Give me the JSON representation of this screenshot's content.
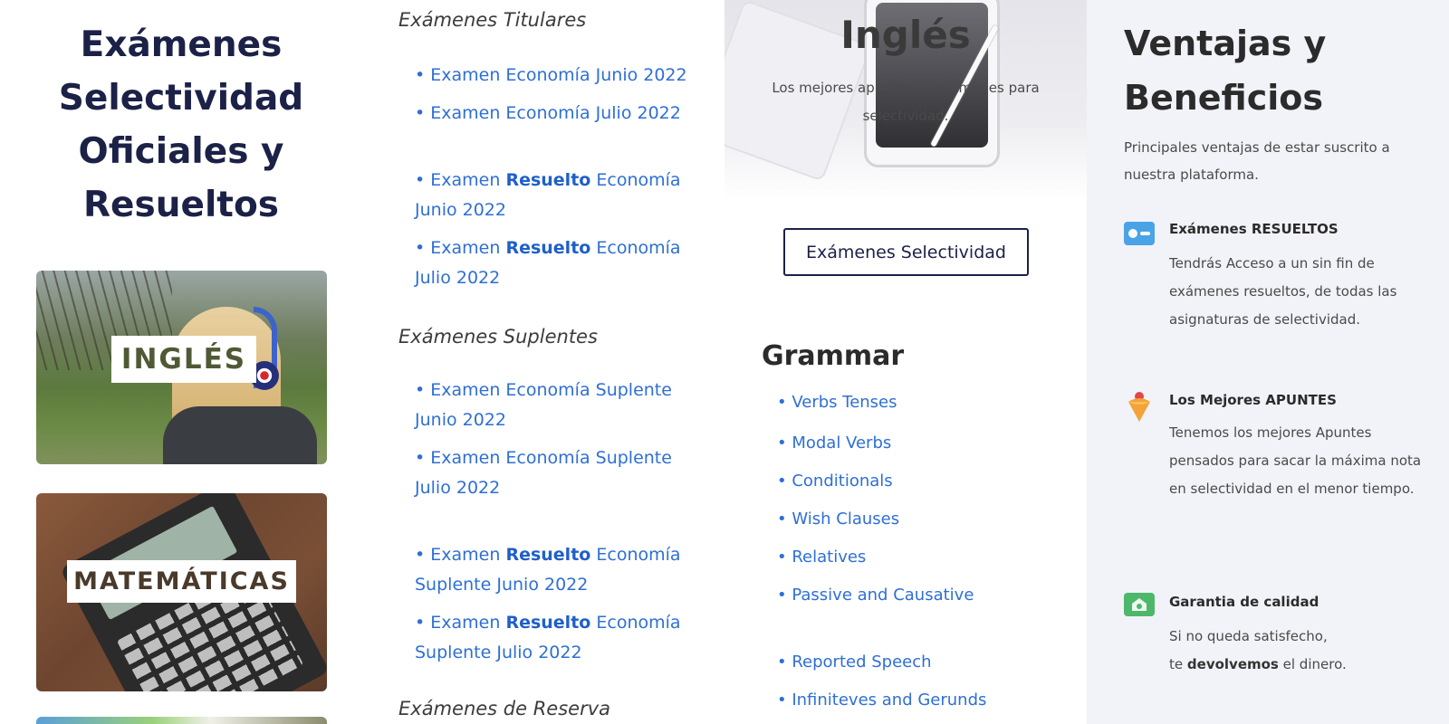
{
  "panel_selectividad": {
    "title": "Exámenes Selectividad Oficiales y Resueltos",
    "cards": [
      {
        "label": "INGLÉS"
      },
      {
        "label": "MATEMÁTICAS"
      }
    ]
  },
  "panel_examenes": {
    "sections": [
      {
        "heading": "Exámenes Titulares"
      },
      {
        "heading": "Exámenes Suplentes"
      },
      {
        "heading": "Exámenes de Reserva"
      }
    ],
    "links": {
      "titular_junio": "• Examen Economía Junio 2022",
      "titular_julio": "• Examen Economía Julio 2022",
      "resuelto_prefix": "• Examen",
      "resuelto_word": "Resuelto",
      "resuelto_junio_rest": "Economía Junio 2022",
      "resuelto_julio_rest": "Economía Julio 2022",
      "suplente_junio": "• Examen Economía Suplente Junio 2022",
      "suplente_julio": "• Examen Economía Suplente Julio 2022",
      "resuelto_suplente_junio_rest": "Economía Suplente Junio 2022",
      "resuelto_suplente_julio_rest": "Economía Suplente Julio 2022"
    }
  },
  "panel_ingles": {
    "hero_title": "Inglés",
    "hero_subtitle": "Los mejores apuntes y resúmenes para selectividad.",
    "button_label": "Exámenes Selectividad",
    "grammar_title": "Grammar",
    "grammar_links": [
      "• Verbs Tenses",
      "• Modal Verbs",
      "• Conditionals",
      "• Wish Clauses",
      "• Relatives",
      "• Passive and Causative",
      "• Reported Speech",
      "• Infiniteves and Gerunds"
    ]
  },
  "panel_beneficios": {
    "title": "Ventajas y Beneficios",
    "subtitle": "Principales ventajas de estar suscrito a nuestra plataforma.",
    "items": [
      {
        "icon": "id-card-icon",
        "heading": "Exámenes RESUELTOS",
        "text": "Tendrás Acceso a un sin fin de exámenes resueltos, de todas las asignaturas de selectividad."
      },
      {
        "icon": "ice-cream-icon",
        "heading": "Los Mejores APUNTES",
        "text": "Tenemos los mejores Apuntes pensados para sacar la máxima nota en selectividad en el menor tiempo."
      },
      {
        "icon": "shield-icon",
        "heading": "Garantia de calidad",
        "text_line1": "Si no queda satisfecho,",
        "text_line2_prefix": "te",
        "text_line2_bold": "devolvemos",
        "text_line2_suffix": "el dinero."
      }
    ]
  },
  "colors": {
    "navy": "#1b2147",
    "link_blue": "#2e6fd6",
    "panel_bg": "#f2f3f9"
  }
}
